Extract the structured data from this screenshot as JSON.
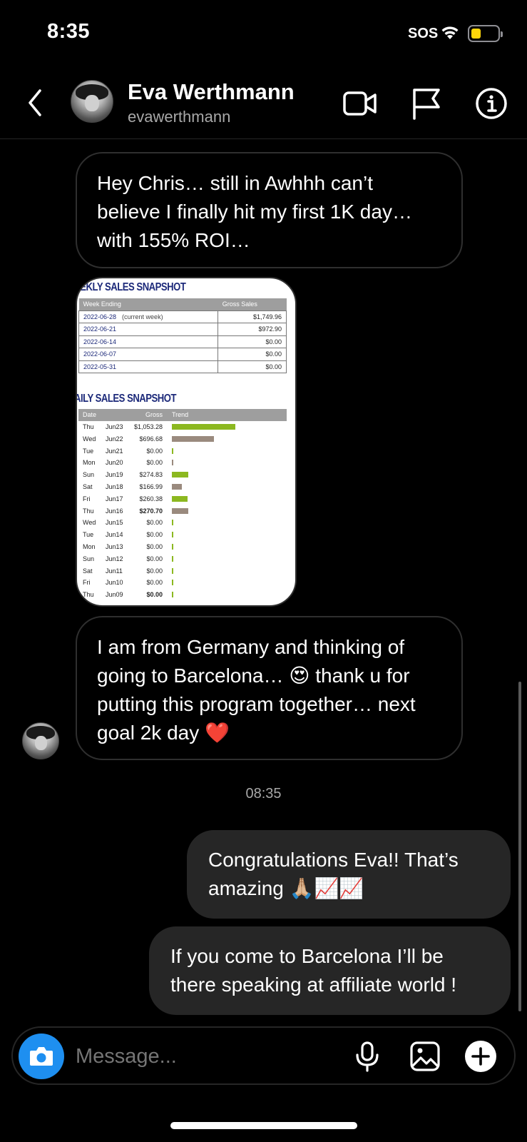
{
  "status_bar": {
    "time": "8:35",
    "carrier": "SOS"
  },
  "header": {
    "name": "Eva Werthmann",
    "username": "evawerthmann"
  },
  "messages": {
    "m1": "Hey Chris… still in Awhhh can’t believe I finally hit my first 1K day… with 155% ROI…",
    "m2": "I am from Germany and thinking of going to Barcelona… 😍 thank u for putting this program together… next goal 2k day ❤️",
    "timestamp": "08:35",
    "m3": "Congratulations Eva!! That’s amazing 🙏🏼📈📈",
    "m4": "If you come to Barcelona I’ll be there speaking at affiliate world !"
  },
  "sales_image": {
    "weekly_title": "EEKLY SALES SNAPSHOT",
    "weekly_headers": {
      "week": "Week Ending",
      "gross": "Gross Sales"
    },
    "weekly_rows": [
      {
        "week": "2022-06-28",
        "note": "(current week)",
        "gross": "$1,749.96"
      },
      {
        "week": "2022-06-21",
        "note": "",
        "gross": "$972.90"
      },
      {
        "week": "2022-06-14",
        "note": "",
        "gross": "$0.00"
      },
      {
        "week": "2022-06-07",
        "note": "",
        "gross": "$0.00"
      },
      {
        "week": "2022-05-31",
        "note": "",
        "gross": "$0.00"
      }
    ],
    "daily_title": "AILY SALES SNAPSHOT",
    "daily_headers": {
      "date": "Date",
      "gross": "Gross",
      "trend": "Trend"
    },
    "daily_rows": [
      {
        "dow": "Thu",
        "date": "Jun23",
        "gross": "$1,053.28",
        "value": 1053.28,
        "color": "#8cb820",
        "bold": false
      },
      {
        "dow": "Wed",
        "date": "Jun22",
        "gross": "$696.68",
        "value": 696.68,
        "color": "#9a8a7e",
        "bold": false
      },
      {
        "dow": "Tue",
        "date": "Jun21",
        "gross": "$0.00",
        "value": 0,
        "color": "#8cb820",
        "bold": false
      },
      {
        "dow": "Mon",
        "date": "Jun20",
        "gross": "$0.00",
        "value": 0,
        "color": "#9a8a7e",
        "bold": false
      },
      {
        "dow": "Sun",
        "date": "Jun19",
        "gross": "$274.83",
        "value": 274.83,
        "color": "#8cb820",
        "bold": false
      },
      {
        "dow": "Sat",
        "date": "Jun18",
        "gross": "$166.99",
        "value": 166.99,
        "color": "#9a8a7e",
        "bold": false
      },
      {
        "dow": "Fri",
        "date": "Jun17",
        "gross": "$260.38",
        "value": 260.38,
        "color": "#8cb820",
        "bold": false
      },
      {
        "dow": "Thu",
        "date": "Jun16",
        "gross": "$270.70",
        "value": 270.7,
        "color": "#9a8a7e",
        "bold": true
      },
      {
        "dow": "Wed",
        "date": "Jun15",
        "gross": "$0.00",
        "value": 0,
        "color": "#8cb820",
        "bold": false
      },
      {
        "dow": "Tue",
        "date": "Jun14",
        "gross": "$0.00",
        "value": 0,
        "color": "#8cb820",
        "bold": false
      },
      {
        "dow": "Mon",
        "date": "Jun13",
        "gross": "$0.00",
        "value": 0,
        "color": "#8cb820",
        "bold": false
      },
      {
        "dow": "Sun",
        "date": "Jun12",
        "gross": "$0.00",
        "value": 0,
        "color": "#8cb820",
        "bold": false
      },
      {
        "dow": "Sat",
        "date": "Jun11",
        "gross": "$0.00",
        "value": 0,
        "color": "#8cb820",
        "bold": false
      },
      {
        "dow": "Fri",
        "date": "Jun10",
        "gross": "$0.00",
        "value": 0,
        "color": "#8cb820",
        "bold": false
      },
      {
        "dow": "Thu",
        "date": "Jun09",
        "gross": "$0.00",
        "value": 0,
        "color": "#8cb820",
        "bold": true
      }
    ]
  },
  "composer": {
    "placeholder": "Message..."
  },
  "icons": {
    "back": "chevron-left-icon",
    "video": "video-camera-icon",
    "report": "flag-icon",
    "info": "info-icon",
    "camera": "camera-icon",
    "mic": "microphone-icon",
    "gallery": "image-icon",
    "add": "plus-icon"
  },
  "colors": {
    "accent": "#1e8ff0",
    "outgoing_bubble": "#262626",
    "incoming_border": "#2f2f2f"
  }
}
